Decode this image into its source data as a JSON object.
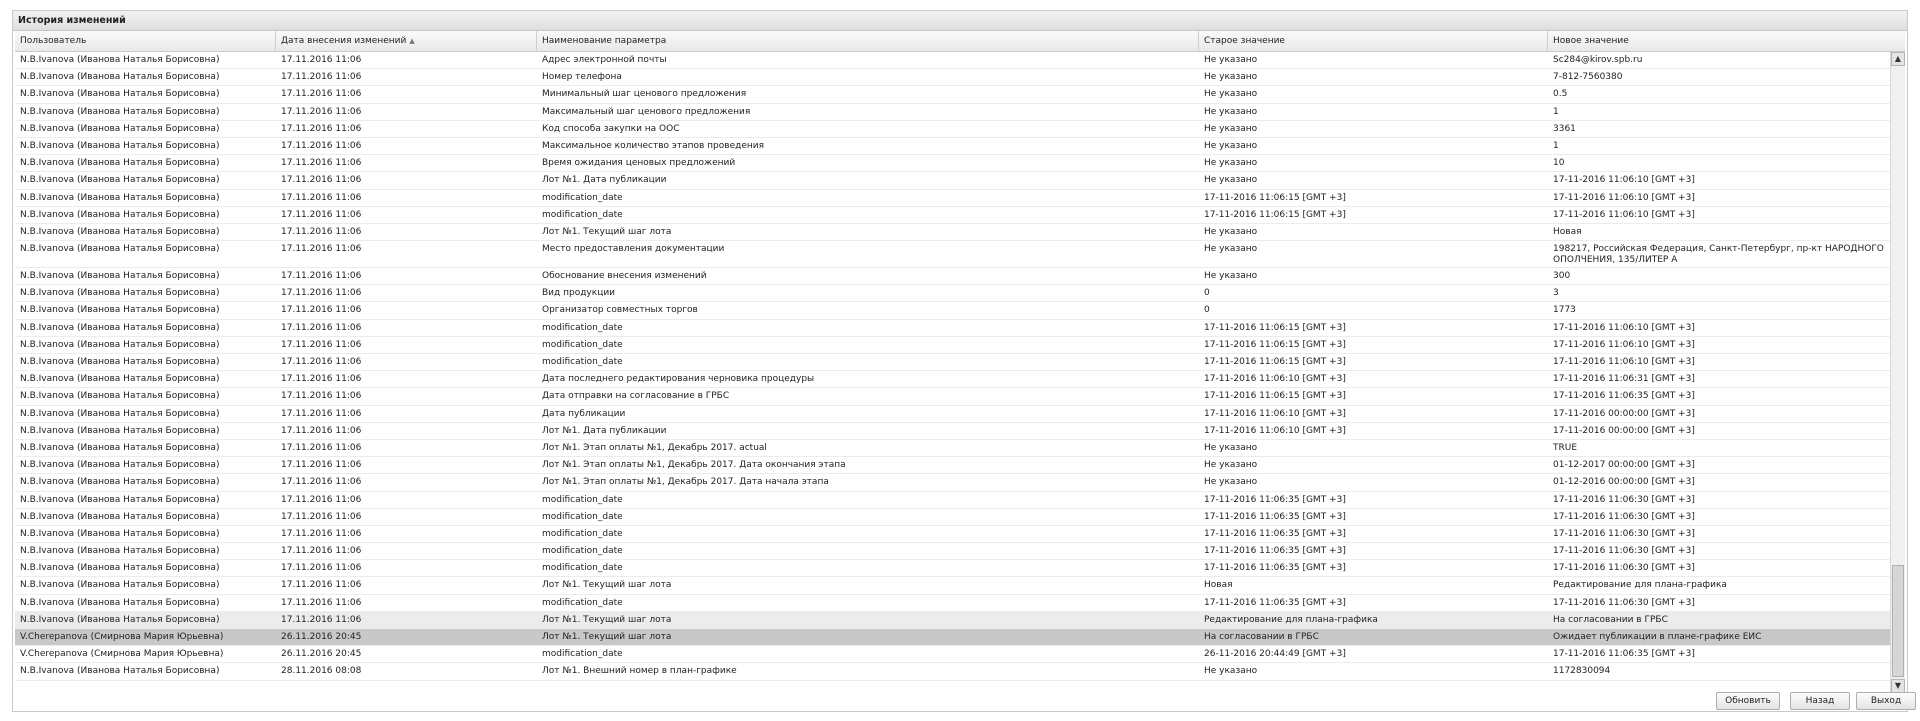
{
  "panel": {
    "title": "История изменений"
  },
  "columns": [
    {
      "label": "Пользователь"
    },
    {
      "label": "Дата внесения изменений",
      "sort": "asc"
    },
    {
      "label": "Наименование параметра"
    },
    {
      "label": "Старое значение"
    },
    {
      "label": "Новое значение"
    }
  ],
  "rows": [
    [
      "N.B.Ivanova (Иванова Наталья Борисовна)",
      "17.11.2016 11:06",
      "Адрес электронной почты",
      "Не указано",
      "Sc284@kirov.spb.ru"
    ],
    [
      "N.B.Ivanova (Иванова Наталья Борисовна)",
      "17.11.2016 11:06",
      "Номер телефона",
      "Не указано",
      "7-812-7560380"
    ],
    [
      "N.B.Ivanova (Иванова Наталья Борисовна)",
      "17.11.2016 11:06",
      "Минимальный шаг ценового предложения",
      "Не указано",
      "0.5"
    ],
    [
      "N.B.Ivanova (Иванова Наталья Борисовна)",
      "17.11.2016 11:06",
      "Максимальный шаг ценового предложения",
      "Не указано",
      "1"
    ],
    [
      "N.B.Ivanova (Иванова Наталья Борисовна)",
      "17.11.2016 11:06",
      "Код способа закупки на ООС",
      "Не указано",
      "3361"
    ],
    [
      "N.B.Ivanova (Иванова Наталья Борисовна)",
      "17.11.2016 11:06",
      "Максимальное количество этапов проведения",
      "Не указано",
      "1"
    ],
    [
      "N.B.Ivanova (Иванова Наталья Борисовна)",
      "17.11.2016 11:06",
      "Время ожидания ценовых предложений",
      "Не указано",
      "10"
    ],
    [
      "N.B.Ivanova (Иванова Наталья Борисовна)",
      "17.11.2016 11:06",
      "Лот №1. Дата публикации",
      "Не указано",
      "17-11-2016 11:06:10 [GMT +3]"
    ],
    [
      "N.B.Ivanova (Иванова Наталья Борисовна)",
      "17.11.2016 11:06",
      "modification_date",
      "17-11-2016 11:06:15 [GMT +3]",
      "17-11-2016 11:06:10 [GMT +3]"
    ],
    [
      "N.B.Ivanova (Иванова Наталья Борисовна)",
      "17.11.2016 11:06",
      "modification_date",
      "17-11-2016 11:06:15 [GMT +3]",
      "17-11-2016 11:06:10 [GMT +3]"
    ],
    [
      "N.B.Ivanova (Иванова Наталья Борисовна)",
      "17.11.2016 11:06",
      "Лот №1. Текущий шаг лота",
      "Не указано",
      "Новая"
    ],
    [
      "N.B.Ivanova (Иванова Наталья Борисовна)",
      "17.11.2016 11:06",
      "Место предоставления документации",
      "Не указано",
      "198217, Российская Федерация, Санкт-Петербург, пр-кт НАРОДНОГО ОПОЛЧЕНИЯ, 135/ЛИТЕР А"
    ],
    [
      "N.B.Ivanova (Иванова Наталья Борисовна)",
      "17.11.2016 11:06",
      "Обоснование внесения изменений",
      "Не указано",
      "300"
    ],
    [
      "N.B.Ivanova (Иванова Наталья Борисовна)",
      "17.11.2016 11:06",
      "Вид продукции",
      "0",
      "3"
    ],
    [
      "N.B.Ivanova (Иванова Наталья Борисовна)",
      "17.11.2016 11:06",
      "Организатор совместных торгов",
      "0",
      "1773"
    ],
    [
      "N.B.Ivanova (Иванова Наталья Борисовна)",
      "17.11.2016 11:06",
      "modification_date",
      "17-11-2016 11:06:15 [GMT +3]",
      "17-11-2016 11:06:10 [GMT +3]"
    ],
    [
      "N.B.Ivanova (Иванова Наталья Борисовна)",
      "17.11.2016 11:06",
      "modification_date",
      "17-11-2016 11:06:15 [GMT +3]",
      "17-11-2016 11:06:10 [GMT +3]"
    ],
    [
      "N.B.Ivanova (Иванова Наталья Борисовна)",
      "17.11.2016 11:06",
      "modification_date",
      "17-11-2016 11:06:15 [GMT +3]",
      "17-11-2016 11:06:10 [GMT +3]"
    ],
    [
      "N.B.Ivanova (Иванова Наталья Борисовна)",
      "17.11.2016 11:06",
      "Дата последнего редактирования черновика процедуры",
      "17-11-2016 11:06:10 [GMT +3]",
      "17-11-2016 11:06:31 [GMT +3]"
    ],
    [
      "N.B.Ivanova (Иванова Наталья Борисовна)",
      "17.11.2016 11:06",
      "Дата отправки на согласование в ГРБС",
      "17-11-2016 11:06:15 [GMT +3]",
      "17-11-2016 11:06:35 [GMT +3]"
    ],
    [
      "N.B.Ivanova (Иванова Наталья Борисовна)",
      "17.11.2016 11:06",
      "Дата публикации",
      "17-11-2016 11:06:10 [GMT +3]",
      "17-11-2016 00:00:00 [GMT +3]"
    ],
    [
      "N.B.Ivanova (Иванова Наталья Борисовна)",
      "17.11.2016 11:06",
      "Лот №1. Дата публикации",
      "17-11-2016 11:06:10 [GMT +3]",
      "17-11-2016 00:00:00 [GMT +3]"
    ],
    [
      "N.B.Ivanova (Иванова Наталья Борисовна)",
      "17.11.2016 11:06",
      "Лот №1. Этап оплаты №1, Декабрь 2017. actual",
      "Не указано",
      "TRUE"
    ],
    [
      "N.B.Ivanova (Иванова Наталья Борисовна)",
      "17.11.2016 11:06",
      "Лот №1. Этап оплаты №1, Декабрь 2017. Дата окончания этапа",
      "Не указано",
      "01-12-2017 00:00:00 [GMT +3]"
    ],
    [
      "N.B.Ivanova (Иванова Наталья Борисовна)",
      "17.11.2016 11:06",
      "Лот №1. Этап оплаты №1, Декабрь 2017. Дата начала этапа",
      "Не указано",
      "01-12-2016 00:00:00 [GMT +3]"
    ],
    [
      "N.B.Ivanova (Иванова Наталья Борисовна)",
      "17.11.2016 11:06",
      "modification_date",
      "17-11-2016 11:06:35 [GMT +3]",
      "17-11-2016 11:06:30 [GMT +3]"
    ],
    [
      "N.B.Ivanova (Иванова Наталья Борисовна)",
      "17.11.2016 11:06",
      "modification_date",
      "17-11-2016 11:06:35 [GMT +3]",
      "17-11-2016 11:06:30 [GMT +3]"
    ],
    [
      "N.B.Ivanova (Иванова Наталья Борисовна)",
      "17.11.2016 11:06",
      "modification_date",
      "17-11-2016 11:06:35 [GMT +3]",
      "17-11-2016 11:06:30 [GMT +3]"
    ],
    [
      "N.B.Ivanova (Иванова Наталья Борисовна)",
      "17.11.2016 11:06",
      "modification_date",
      "17-11-2016 11:06:35 [GMT +3]",
      "17-11-2016 11:06:30 [GMT +3]"
    ],
    [
      "N.B.Ivanova (Иванова Наталья Борисовна)",
      "17.11.2016 11:06",
      "modification_date",
      "17-11-2016 11:06:35 [GMT +3]",
      "17-11-2016 11:06:30 [GMT +3]"
    ],
    [
      "N.B.Ivanova (Иванова Наталья Борисовна)",
      "17.11.2016 11:06",
      "Лот №1. Текущий шаг лота",
      "Новая",
      "Редактирование для плана-графика"
    ],
    [
      "N.B.Ivanova (Иванова Наталья Борисовна)",
      "17.11.2016 11:06",
      "modification_date",
      "17-11-2016 11:06:35 [GMT +3]",
      "17-11-2016 11:06:30 [GMT +3]"
    ],
    [
      "N.B.Ivanova (Иванова Наталья Борисовна)",
      "17.11.2016 11:06",
      "Лот №1. Текущий шаг лота",
      "Редактирование для плана-графика",
      "На согласовании в ГРБС"
    ],
    [
      "V.Cherepanova (Смирнова Мария Юрьевна)",
      "26.11.2016 20:45",
      "Лот №1. Текущий шаг лота",
      "На согласовании в ГРБС",
      "Ожидает публикации в плане-графике ЕИС"
    ],
    [
      "V.Cherepanova (Смирнова Мария Юрьевна)",
      "26.11.2016 20:45",
      "modification_date",
      "26-11-2016 20:44:49 [GMT +3]",
      "17-11-2016 11:06:35 [GMT +3]"
    ],
    [
      "N.B.Ivanova (Иванова Наталья Борисовна)",
      "28.11.2016 08:08",
      "Лот №1. Внешний номер в план-графике",
      "Не указано",
      "1172830094"
    ]
  ],
  "highlight": {
    "hover_row": 32,
    "selected_row": 33
  },
  "buttons": {
    "refresh": "Обновить",
    "back": "Назад",
    "exit": "Выход"
  },
  "scrollbar": {
    "up_icon": "▲",
    "down_icon": "▼"
  }
}
